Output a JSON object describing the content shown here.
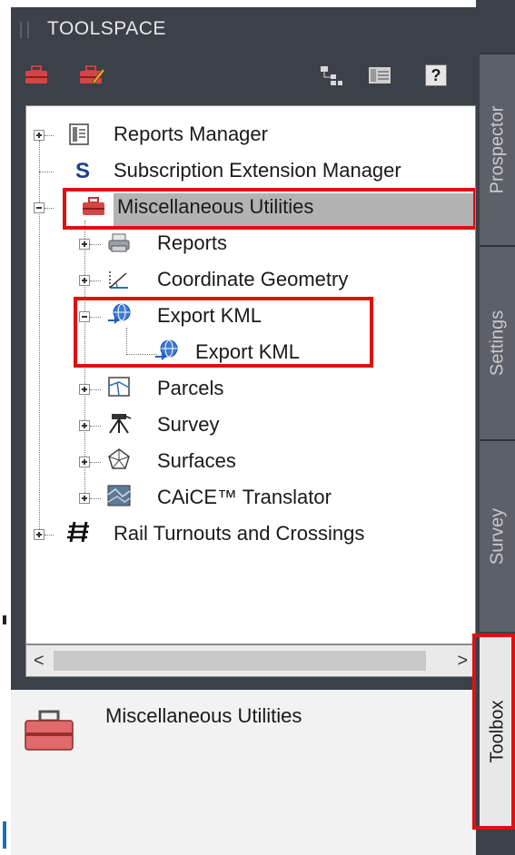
{
  "panel": {
    "title": "TOOLSPACE"
  },
  "tree": {
    "items": [
      {
        "label": "Reports Manager"
      },
      {
        "label": "Subscription Extension Manager"
      },
      {
        "label": "Miscellaneous Utilities"
      },
      {
        "label": "Reports"
      },
      {
        "label": "Coordinate Geometry"
      },
      {
        "label": "Export KML"
      },
      {
        "label": "Export KML"
      },
      {
        "label": "Parcels"
      },
      {
        "label": "Survey"
      },
      {
        "label": "Surfaces"
      },
      {
        "label": "CAiCE™ Translator"
      },
      {
        "label": "Rail Turnouts and Crossings"
      }
    ],
    "subscription_icon_letter": "S"
  },
  "scroll": {
    "left_arrow": "<",
    "right_arrow": ">"
  },
  "detail": {
    "label": "Miscellaneous Utilities"
  },
  "toolbar": {
    "help_label": "?"
  },
  "side_tabs": [
    {
      "label": "Prospector"
    },
    {
      "label": "Settings"
    },
    {
      "label": "Survey"
    },
    {
      "label": "Toolbox"
    }
  ],
  "colors": {
    "panel_dark": "#3b4049",
    "highlight_red": "#e01010",
    "selection_gray": "#b3b3b3"
  }
}
